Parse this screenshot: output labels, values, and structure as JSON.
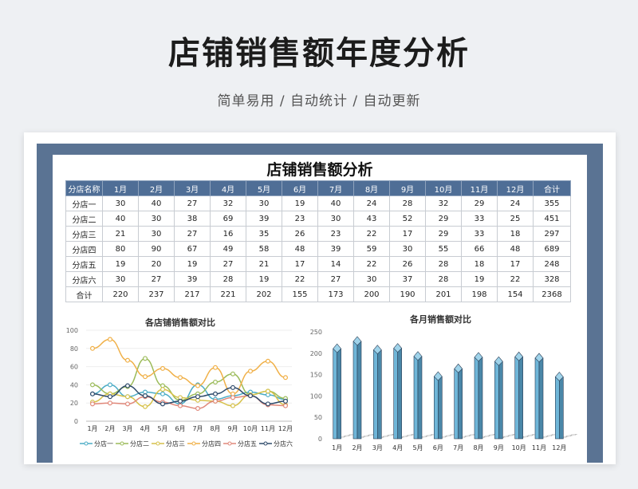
{
  "header": {
    "title": "店铺销售额年度分析",
    "subtitle": "简单易用 / 自动统计 / 自动更新"
  },
  "sheet": {
    "title": "店铺销售额分析",
    "columns": [
      "分店名称",
      "1月",
      "2月",
      "3月",
      "4月",
      "5月",
      "6月",
      "7月",
      "8月",
      "9月",
      "10月",
      "11月",
      "12月",
      "合计"
    ],
    "rows": [
      {
        "name": "分店一",
        "values": [
          30,
          40,
          27,
          32,
          30,
          19,
          40,
          24,
          28,
          32,
          29,
          24
        ],
        "total": 355
      },
      {
        "name": "分店二",
        "values": [
          40,
          30,
          38,
          69,
          39,
          23,
          30,
          43,
          52,
          29,
          33,
          25
        ],
        "total": 451
      },
      {
        "name": "分店三",
        "values": [
          21,
          30,
          27,
          16,
          35,
          26,
          23,
          22,
          17,
          29,
          33,
          18
        ],
        "total": 297
      },
      {
        "name": "分店四",
        "values": [
          80,
          90,
          67,
          49,
          58,
          48,
          39,
          59,
          30,
          55,
          66,
          48
        ],
        "total": 689
      },
      {
        "name": "分店五",
        "values": [
          19,
          20,
          19,
          27,
          21,
          17,
          14,
          22,
          26,
          28,
          18,
          17
        ],
        "total": 248
      },
      {
        "name": "分店六",
        "values": [
          30,
          27,
          39,
          28,
          19,
          22,
          27,
          30,
          37,
          28,
          19,
          22
        ],
        "total": 328
      }
    ],
    "sum_row": {
      "name": "合计",
      "values": [
        220,
        237,
        217,
        221,
        202,
        155,
        173,
        200,
        190,
        201,
        198,
        154
      ],
      "total": 2368
    }
  },
  "chart_data": [
    {
      "type": "line",
      "title": "各店铺销售额对比",
      "x": [
        "1月",
        "2月",
        "3月",
        "4月",
        "5月",
        "6月",
        "7月",
        "8月",
        "9月",
        "10月",
        "11月",
        "12月"
      ],
      "ylim": [
        0,
        100
      ],
      "yticks": [
        0,
        20,
        40,
        60,
        80,
        100
      ],
      "legend_position": "bottom",
      "series": [
        {
          "name": "分店一",
          "color": "#4bacc6",
          "values": [
            30,
            40,
            27,
            32,
            30,
            19,
            40,
            24,
            28,
            32,
            29,
            24
          ]
        },
        {
          "name": "分店二",
          "color": "#9bbb59",
          "values": [
            40,
            30,
            38,
            69,
            39,
            23,
            30,
            43,
            52,
            29,
            33,
            25
          ]
        },
        {
          "name": "分店三",
          "color": "#d6c14a",
          "values": [
            21,
            30,
            27,
            16,
            35,
            26,
            23,
            22,
            17,
            29,
            33,
            18
          ]
        },
        {
          "name": "分店四",
          "color": "#f0b048",
          "values": [
            80,
            90,
            67,
            49,
            58,
            48,
            39,
            59,
            30,
            55,
            66,
            48
          ]
        },
        {
          "name": "分店五",
          "color": "#e0887a",
          "values": [
            19,
            20,
            19,
            27,
            21,
            17,
            14,
            22,
            26,
            28,
            18,
            17
          ]
        },
        {
          "name": "分店六",
          "color": "#2e4a6b",
          "values": [
            30,
            27,
            39,
            28,
            19,
            22,
            27,
            30,
            37,
            28,
            19,
            22
          ]
        }
      ]
    },
    {
      "type": "bar",
      "title": "各月销售额对比",
      "categories": [
        "1月",
        "2月",
        "3月",
        "4月",
        "5月",
        "6月",
        "7月",
        "8月",
        "9月",
        "10月",
        "11月",
        "12月"
      ],
      "values": [
        220,
        237,
        217,
        221,
        202,
        155,
        173,
        200,
        190,
        201,
        198,
        154
      ],
      "ylim": [
        0,
        250
      ],
      "yticks": [
        0,
        50,
        100,
        150,
        200,
        250
      ],
      "color": "#6fb6d8"
    }
  ]
}
